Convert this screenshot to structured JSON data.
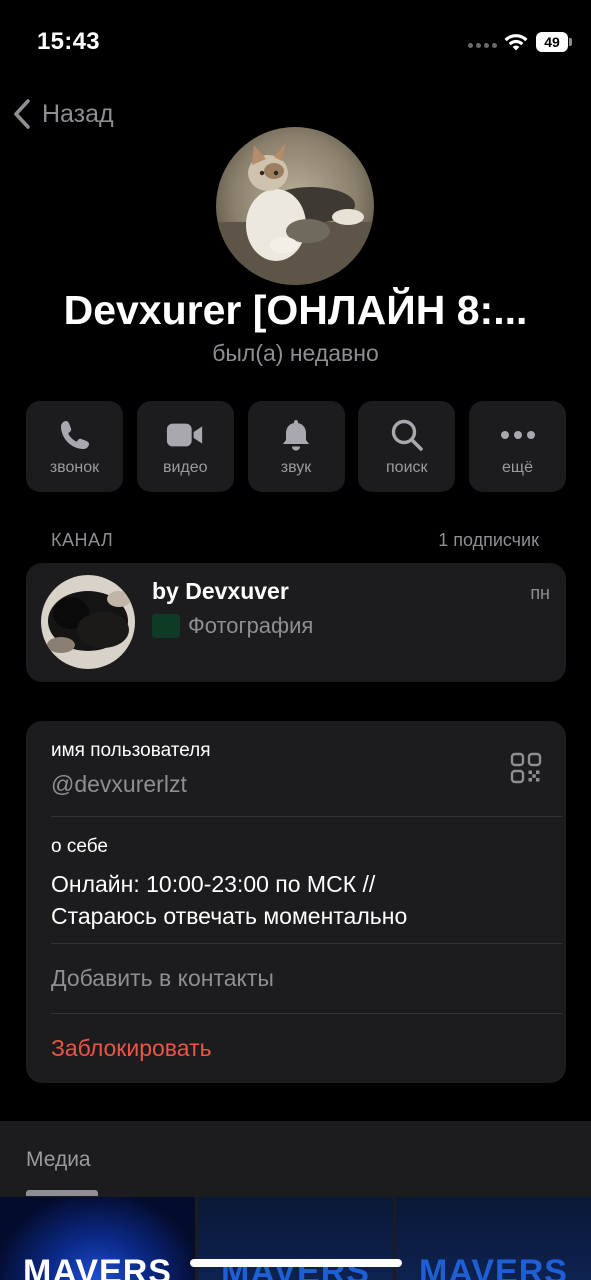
{
  "status_bar": {
    "time": "15:43",
    "battery": "49"
  },
  "nav": {
    "back_label": "Назад"
  },
  "profile": {
    "name": "Devxurer [ОНЛАЙН 8:...",
    "status": "был(а) недавно",
    "avatar_icon": "cat-photo-avatar"
  },
  "actions": [
    {
      "label": "звонок",
      "icon": "phone-icon"
    },
    {
      "label": "видео",
      "icon": "video-camera-icon"
    },
    {
      "label": "звук",
      "icon": "bell-icon"
    },
    {
      "label": "поиск",
      "icon": "search-icon"
    },
    {
      "label": "ещё",
      "icon": "more-dots-icon"
    }
  ],
  "channel": {
    "section_label": "КАНАЛ",
    "subscribers": "1 подписчик",
    "name": "by Devxuver",
    "time": "пн",
    "preview": "Фотография"
  },
  "info": {
    "username_label": "имя пользователя",
    "username": "@devxurerlzt",
    "about_label": "о себе",
    "about_line1": "Онлайн: 10:00-23:00 по МСК //",
    "about_line2": "Стараюсь отвечать моментально",
    "add_contact": "Добавить в контакты",
    "block": "Заблокировать"
  },
  "media": {
    "title": "Медиа",
    "thumb_text": "MAVERS"
  },
  "colors": {
    "background": "#000000",
    "card": "#1c1c1e",
    "secondary_text": "#8e8e93",
    "destructive": "#eb5545"
  }
}
